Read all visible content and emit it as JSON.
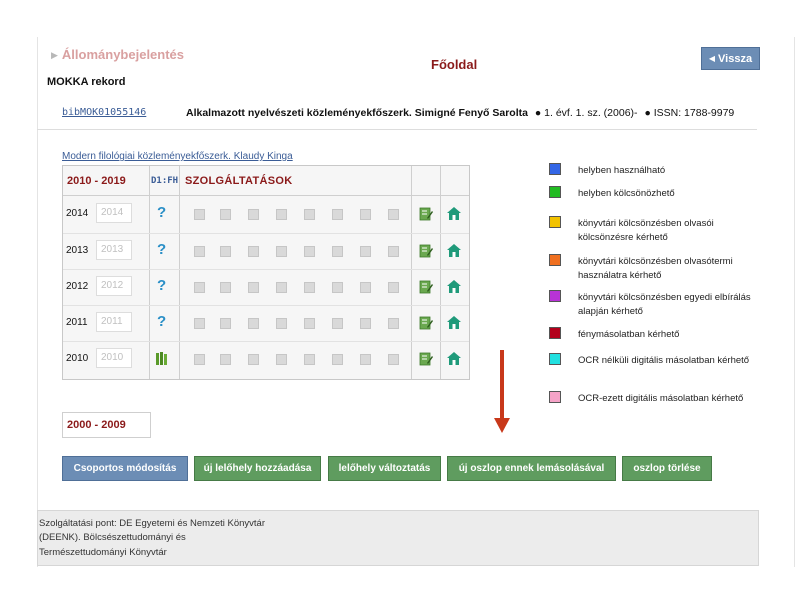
{
  "breadcrumb": {
    "home": "Főoldal",
    "current": "Állománybejelentés"
  },
  "back_button": "Vissza",
  "record_title": "MOKKA rekord",
  "record": {
    "id": "bibMOK01055146",
    "title": "Alkalmazott nyelvészeti közleményekfőszerk. Simigné Fenyő Sarolta",
    "issue": "1. évf. 1. sz. (2006)-",
    "issn": "ISSN: 1788-9979"
  },
  "sublink": "Modern filológiai közleményekfőszerk. Klaudy Kinga",
  "grid": {
    "decade_label": "2010 - 2019",
    "d1_label": "D1:FH",
    "services_label": "SZOLGÁLTATÁSOK",
    "rows": [
      {
        "year": "2014",
        "input_value": "2014",
        "status": "question"
      },
      {
        "year": "2013",
        "input_value": "2013",
        "status": "question"
      },
      {
        "year": "2012",
        "input_value": "2012",
        "status": "question"
      },
      {
        "year": "2011",
        "input_value": "2011",
        "status": "question"
      },
      {
        "year": "2010",
        "input_value": "2010",
        "status": "books"
      }
    ]
  },
  "decade2_label": "2000 - 2009",
  "buttons": {
    "bulk_edit": "Csoportos módosítás",
    "add_location": "új lelőhely hozzáadása",
    "change_location": "lelőhely változtatás",
    "copy_column": "új oszlop ennek lemásolásával",
    "delete_column": "oszlop törlése"
  },
  "legend": [
    {
      "label": "helyben használható",
      "color": "#3366e6"
    },
    {
      "label": "helyben kölcsönözhető",
      "color": "#22bb22"
    },
    {
      "label": "könyvtári kölcsönzésben olvasói kölcsönzésre kérhető",
      "color": "#f2c200"
    },
    {
      "label": "könyvtári kölcsönzésben olvasótermi használatra kérhető",
      "color": "#f07020"
    },
    {
      "label": "könyvtári kölcsönzésben egyedi elbírálás alapján kérhető",
      "color": "#b833d6"
    },
    {
      "label": "fénymásolatban kérhető",
      "color": "#b3001b"
    },
    {
      "label": "OCR nélküli digitális másolatban kérhető",
      "color": "#22e0e0"
    },
    {
      "label": "OCR-ezett digitális másolatban kérhető",
      "color": "#f5a3c7"
    }
  ],
  "footer": {
    "line1": "Szolgáltatási pont: DE Egyetemi és Nemzeti Könyvtár",
    "line2": "(DEENK). Bölcsészettudományi és",
    "line3": "Természettudományi Könyvtár"
  },
  "colors": {
    "brand_red": "#8b1a1a",
    "link_blue": "#3a5c96",
    "button_blue": "#6c8db5",
    "button_green": "#5f9c5f",
    "arrow_red": "#c8381a"
  },
  "icons": {
    "question": "question-mark-icon",
    "books": "books-icon",
    "edit": "edit-icon",
    "home": "home-icon",
    "back": "triangle-left-icon",
    "arrow": "arrow-down-icon"
  }
}
